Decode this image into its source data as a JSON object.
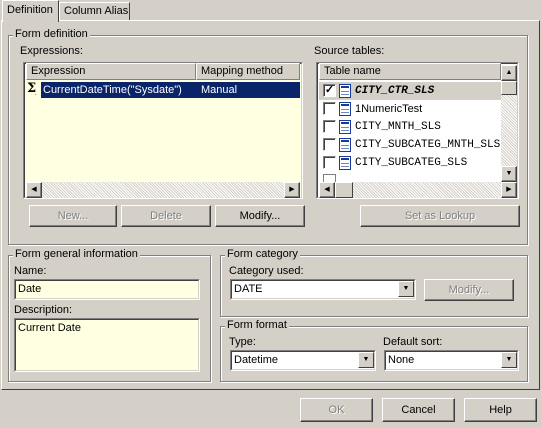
{
  "tabs": [
    {
      "label": "Definition",
      "active": true
    },
    {
      "label": "Column Alias",
      "active": false
    }
  ],
  "form_definition": {
    "title": "Form definition",
    "expressions_label": "Expressions:",
    "columns": [
      "Expression",
      "Mapping method"
    ],
    "rows": [
      {
        "icon": "sigma-icon",
        "expression": "CurrentDateTime(\"Sysdate\")",
        "mapping": "Manual",
        "selected": true
      }
    ],
    "buttons": {
      "new": "New...",
      "delete": "Delete",
      "modify": "Modify..."
    },
    "source_tables_label": "Source tables:",
    "source_table_header": "Table name",
    "source_tables": [
      {
        "name": "CITY_CTR_SLS",
        "checked": true,
        "bold": true
      },
      {
        "name": "1NumericTest",
        "checked": false,
        "bold": false
      },
      {
        "name": "CITY_MNTH_SLS",
        "checked": false,
        "bold": false
      },
      {
        "name": "CITY_SUBCATEG_MNTH_SLS",
        "checked": false,
        "bold": false
      },
      {
        "name": "CITY_SUBCATEG_SLS",
        "checked": false,
        "bold": false
      }
    ],
    "set_as_lookup": "Set as Lookup"
  },
  "general_info": {
    "title": "Form general information",
    "name_label": "Name:",
    "name_value": "Date",
    "description_label": "Description:",
    "description_value": "Current Date"
  },
  "category": {
    "title": "Form category",
    "used_label": "Category used:",
    "used_value": "DATE",
    "modify": "Modify..."
  },
  "format": {
    "title": "Form format",
    "type_label": "Type:",
    "type_value": "Datetime",
    "sort_label": "Default sort:",
    "sort_value": "None"
  },
  "footer": {
    "ok": "OK",
    "cancel": "Cancel",
    "help": "Help"
  },
  "colors": {
    "selection": "#0a246a",
    "field_bg": "#ffffe1",
    "face": "#d4d0c8"
  }
}
